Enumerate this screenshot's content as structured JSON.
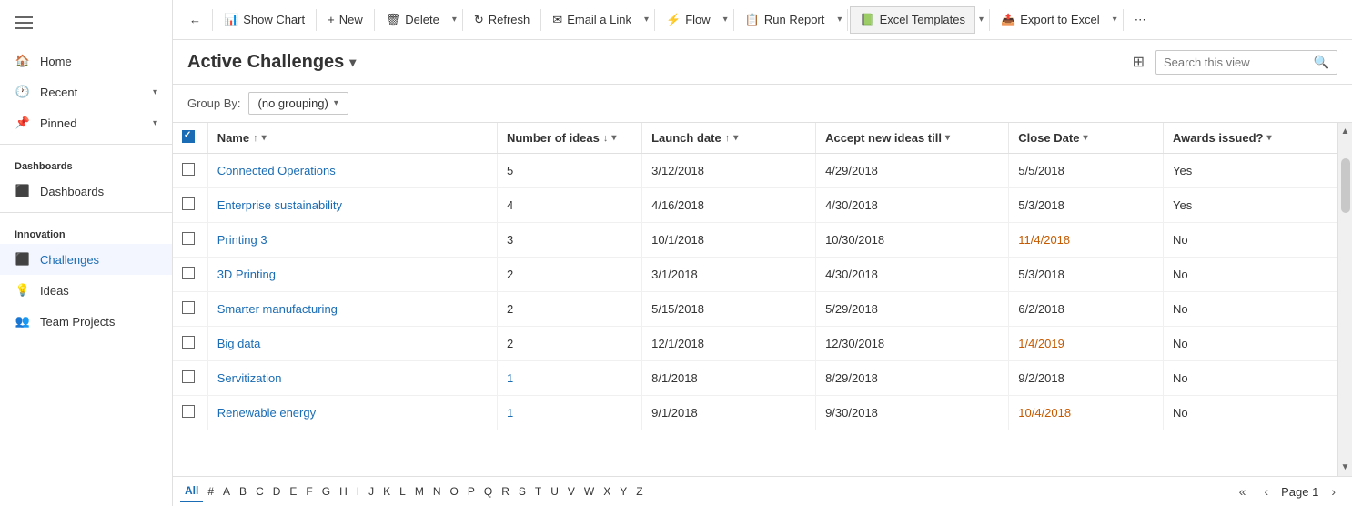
{
  "sidebar": {
    "section_dashboards": "Dashboards",
    "section_innovation": "Innovation",
    "items": [
      {
        "id": "home",
        "label": "Home",
        "icon": "🏠",
        "hasChevron": false
      },
      {
        "id": "recent",
        "label": "Recent",
        "icon": "🕐",
        "hasChevron": true
      },
      {
        "id": "pinned",
        "label": "Pinned",
        "icon": "📌",
        "hasChevron": true
      },
      {
        "id": "dashboards",
        "label": "Dashboards",
        "icon": "⬛",
        "hasChevron": false
      },
      {
        "id": "challenges",
        "label": "Challenges",
        "icon": "⬛",
        "hasChevron": false,
        "active": true
      },
      {
        "id": "ideas",
        "label": "Ideas",
        "icon": "💡",
        "hasChevron": false
      },
      {
        "id": "team-projects",
        "label": "Team Projects",
        "icon": "👥",
        "hasChevron": false
      }
    ]
  },
  "toolbar": {
    "back_label": "←",
    "show_chart_label": "Show Chart",
    "new_label": "New",
    "delete_label": "Delete",
    "refresh_label": "Refresh",
    "email_link_label": "Email a Link",
    "flow_label": "Flow",
    "run_report_label": "Run Report",
    "excel_templates_label": "Excel Templates",
    "export_excel_label": "Export to Excel",
    "more_label": "⋯"
  },
  "header": {
    "title": "Active Challenges",
    "search_placeholder": "Search this view"
  },
  "groupby": {
    "label": "Group By:",
    "value": "(no grouping)"
  },
  "columns": [
    {
      "id": "name",
      "label": "Name",
      "sort": "asc"
    },
    {
      "id": "ideas",
      "label": "Number of ideas",
      "sort": "desc"
    },
    {
      "id": "launch",
      "label": "Launch date",
      "sort": "asc"
    },
    {
      "id": "accept",
      "label": "Accept new ideas till",
      "sort": "none"
    },
    {
      "id": "close",
      "label": "Close Date",
      "sort": "none"
    },
    {
      "id": "awards",
      "label": "Awards issued?",
      "sort": "none"
    }
  ],
  "rows": [
    {
      "name": "Connected Operations",
      "ideas": 5,
      "launch": "3/12/2018",
      "accept": "4/29/2018",
      "close": "5/5/2018",
      "awards": "Yes",
      "name_orange": false,
      "close_orange": false
    },
    {
      "name": "Enterprise sustainability",
      "ideas": 4,
      "launch": "4/16/2018",
      "accept": "4/30/2018",
      "close": "5/3/2018",
      "awards": "Yes",
      "name_orange": false,
      "close_orange": false
    },
    {
      "name": "Printing 3",
      "ideas": 3,
      "launch": "10/1/2018",
      "accept": "10/30/2018",
      "close": "11/4/2018",
      "awards": "No",
      "name_orange": false,
      "close_orange": true
    },
    {
      "name": "3D Printing",
      "ideas": 2,
      "launch": "3/1/2018",
      "accept": "4/30/2018",
      "close": "5/3/2018",
      "awards": "No",
      "name_orange": false,
      "close_orange": false
    },
    {
      "name": "Smarter manufacturing",
      "ideas": 2,
      "launch": "5/15/2018",
      "accept": "5/29/2018",
      "close": "6/2/2018",
      "awards": "No",
      "name_orange": false,
      "close_orange": false
    },
    {
      "name": "Big data",
      "ideas": 2,
      "launch": "12/1/2018",
      "accept": "12/30/2018",
      "close": "1/4/2019",
      "awards": "No",
      "name_orange": false,
      "close_orange": true
    },
    {
      "name": "Servitization",
      "ideas": 1,
      "launch": "8/1/2018",
      "accept": "8/29/2018",
      "close": "9/2/2018",
      "awards": "No",
      "name_orange": false,
      "close_orange": false
    },
    {
      "name": "Renewable energy",
      "ideas": 1,
      "launch": "9/1/2018",
      "accept": "9/30/2018",
      "close": "10/4/2018",
      "awards": "No",
      "name_orange": false,
      "close_orange": true
    }
  ],
  "pagination": {
    "page_label": "Page 1",
    "alphabet": [
      "All",
      "#",
      "A",
      "B",
      "C",
      "D",
      "E",
      "F",
      "G",
      "H",
      "I",
      "J",
      "K",
      "L",
      "M",
      "N",
      "O",
      "P",
      "Q",
      "R",
      "S",
      "T",
      "U",
      "V",
      "W",
      "X",
      "Y",
      "Z"
    ]
  },
  "colors": {
    "link": "#1a6cb4",
    "orange": "#c55a00",
    "active_alpha": "#1a6cb4"
  }
}
